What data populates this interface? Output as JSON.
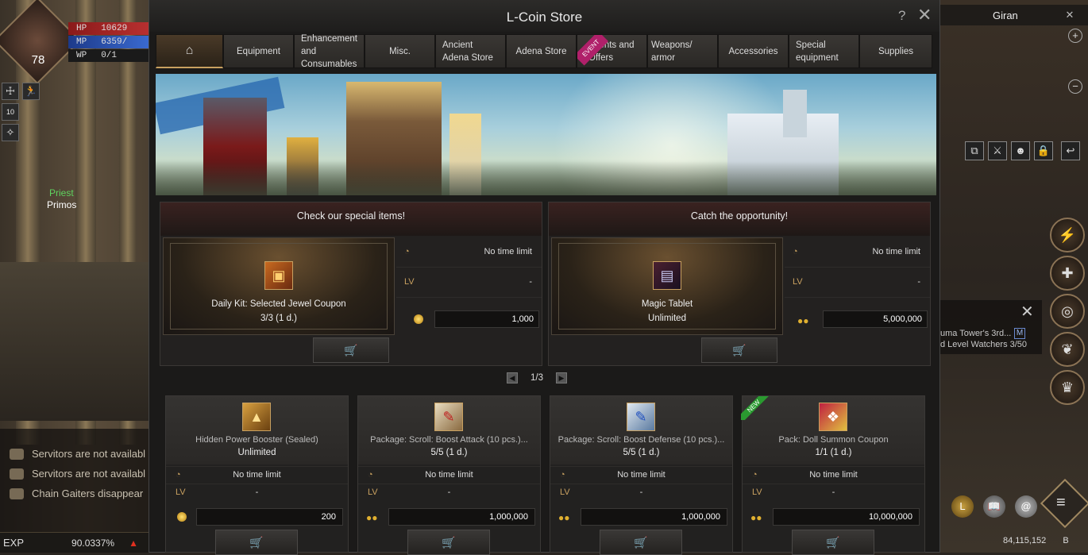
{
  "hud": {
    "level": "78",
    "hp_label": "HP",
    "hp_value": "10629",
    "mp_label": "MP",
    "mp_value": "6359/",
    "wp_label": "WP",
    "wp_value": "0/1",
    "buff_count": "10",
    "npc_class": "Priest",
    "npc_name": "Primos",
    "chat": [
      "Servitors are not availabl",
      "Servitors are not availabl",
      "Chain Gaiters   disappear"
    ],
    "exp_label": "EXP",
    "exp_value": "90.0337%"
  },
  "right_panel": {
    "location": "Giran",
    "zoom_in": "+",
    "zoom_out": "−",
    "quest_line1": "uma Tower's 3rd...",
    "quest_line2": "d Level Watchers 3/50",
    "quest_badge": "M",
    "adena_total": "84,115,152",
    "adena_unit": "B"
  },
  "store": {
    "title": "L-Coin Store",
    "help": "?",
    "close": "✕",
    "tabs": [
      {
        "label": "Equipment"
      },
      {
        "label": "Enhancement and Consumables"
      },
      {
        "label": "Misc."
      },
      {
        "label": "Ancient Adena Store"
      },
      {
        "label": "Adena Store"
      },
      {
        "label": "Events and Offers",
        "badge": "EVENT"
      },
      {
        "label": "Weapons/ armor"
      },
      {
        "label": "Accessories"
      },
      {
        "label": "Special equipment"
      },
      {
        "label": "Supplies"
      }
    ],
    "featured": [
      {
        "heading": "Check our special items!",
        "name": "Daily Kit: Selected Jewel Coupon",
        "qty": "3/3 (1 d.)",
        "time": "No time limit",
        "lv_label": "LV",
        "lv": "-",
        "price": "1,000",
        "currency": "lcoin"
      },
      {
        "heading": "Catch the opportunity!",
        "name": "Magic Tablet",
        "qty": "Unlimited",
        "time": "No time limit",
        "lv_label": "LV",
        "lv": "-",
        "price": "5,000,000",
        "currency": "adena"
      }
    ],
    "pagination": "1/3",
    "products": [
      {
        "name": "Hidden Power Booster (Sealed)",
        "qty": "Unlimited",
        "time": "No time limit",
        "lv_label": "LV",
        "lv": "-",
        "price": "200",
        "currency": "lcoin",
        "icon": "pyramid-icon"
      },
      {
        "name": "Package: Scroll: Boost Attack (10 pcs.)...",
        "qty": "5/5 (1 d.)",
        "time": "No time limit",
        "lv_label": "LV",
        "lv": "-",
        "price": "1,000,000",
        "currency": "adena",
        "icon": "scroll-attack-icon"
      },
      {
        "name": "Package: Scroll: Boost Defense (10 pcs.)...",
        "qty": "5/5 (1 d.)",
        "time": "No time limit",
        "lv_label": "LV",
        "lv": "-",
        "price": "1,000,000",
        "currency": "adena",
        "icon": "scroll-defense-icon"
      },
      {
        "name": "Pack: Doll Summon Coupon",
        "qty": "1/1 (1 d.)",
        "time": "No time limit",
        "lv_label": "LV",
        "lv": "-",
        "price": "10,000,000",
        "currency": "adena",
        "icon": "gift-box-icon",
        "badge": "NEW"
      }
    ]
  }
}
